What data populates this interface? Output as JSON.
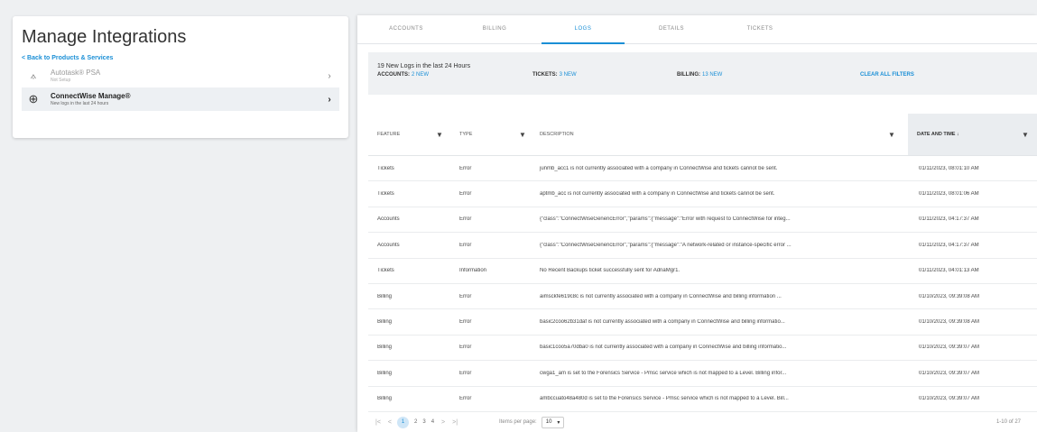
{
  "left": {
    "title": "Manage Integrations",
    "back_link": "< Back to Products & Services",
    "items": [
      {
        "name": "Autotask® PSA",
        "sub": "Not Setup",
        "icon": "autotask-icon"
      },
      {
        "name": "ConnectWise Manage®",
        "sub": "New logs in the last 24 hours",
        "icon": "plus-circle-icon"
      }
    ]
  },
  "tabs": [
    "ACCOUNTS",
    "BILLING",
    "LOGS",
    "DETAILS",
    "TICKETS"
  ],
  "summary": {
    "heading": "19 New Logs in the last 24 Hours",
    "filters": [
      {
        "label": "ACCOUNTS:",
        "count": "2 NEW"
      },
      {
        "label": "TICKETS:",
        "count": "3 NEW"
      },
      {
        "label": "BILLING:",
        "count": "13 NEW"
      }
    ],
    "clear_label": "CLEAR ALL FILTERS"
  },
  "table": {
    "columns": [
      "FEATURE",
      "TYPE",
      "DESCRIPTION",
      "DATE AND TIME ↓"
    ],
    "rows": [
      [
        "Tickets",
        "Error",
        "junmb_acc1 is not currently associated with a company in ConnectWise and tickets cannot be sent.",
        "01/11/2023, 08:01:10 AM"
      ],
      [
        "Tickets",
        "Error",
        "aptmb_acc is not currently associated with a company in ConnectWise and tickets cannot be sent.",
        "01/11/2023, 08:01:06 AM"
      ],
      [
        "Accounts",
        "Error",
        "{\"class\":\"ConnectWiseGenericError\",\"params\":{\"message\":\"Error with request to ConnectWise for integ...",
        "01/11/2023, 04:17:37 AM"
      ],
      [
        "Accounts",
        "Error",
        "{\"class\":\"ConnectWiseGenericError\",\"params\":{\"message\":\"A network-related or instance-specific error ...",
        "01/11/2023, 04:17:37 AM"
      ],
      [
        "Tickets",
        "Information",
        "No Recent Backups ticket successfully sent for AdnaMgr1.",
        "01/11/2023, 04:01:13 AM"
      ],
      [
        "Billing",
        "Error",
        "aimsckfe619c8c is not currently associated with a company in ConnectWise and billing information ...",
        "01/10/2023, 09:39:08 AM"
      ],
      [
        "Billing",
        "Error",
        "basic2coo62b31daf is not currently associated with a company in ConnectWise and billing informatio...",
        "01/10/2023, 09:39:08 AM"
      ],
      [
        "Billing",
        "Error",
        "basic1coo5a70dba0 is not currently associated with a company in ConnectWise and billing informatio...",
        "01/10/2023, 09:39:07 AM"
      ],
      [
        "Billing",
        "Error",
        "cwga1_am is set to the Forensics Service - Pmsc service which is not mapped to a Level. Billing infor...",
        "01/10/2023, 09:39:07 AM"
      ],
      [
        "Billing",
        "Error",
        "ambccuato48a480d is set to the Forensics Service - Pmsc service which is not mapped to a Level. Bill...",
        "01/10/2023, 09:39:07 AM"
      ]
    ]
  },
  "pager": {
    "first": "|<",
    "prev": "<",
    "pages": [
      "1",
      "2",
      "3",
      "4"
    ],
    "active_page": "1",
    "next": ">",
    "last": ">|",
    "items_per_page_label": "Items per page:",
    "items_per_page": "10",
    "range": "1-10 of 27"
  },
  "colors": {
    "accent": "#1a8fd6",
    "panel_bg": "#eff1f3"
  }
}
